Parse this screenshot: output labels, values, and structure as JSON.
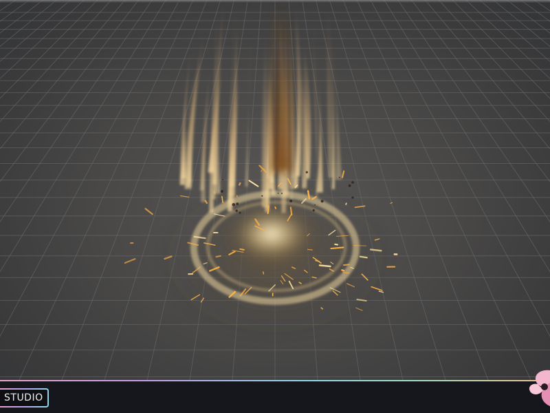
{
  "studio_badge": {
    "label": "STUDIO"
  },
  "viewport": {
    "background_color": "#494847",
    "grid_color": "#6d6d6f",
    "effect_colors": {
      "spark": "#ffb347",
      "flame_core": "#fff2c2",
      "smoke": "#6b4a2a"
    }
  },
  "brand": {
    "logo_icon": "petal-logo-icon",
    "accent_colors": [
      "#f2a0c8",
      "#b8a2ee",
      "#8ed8ea"
    ]
  }
}
